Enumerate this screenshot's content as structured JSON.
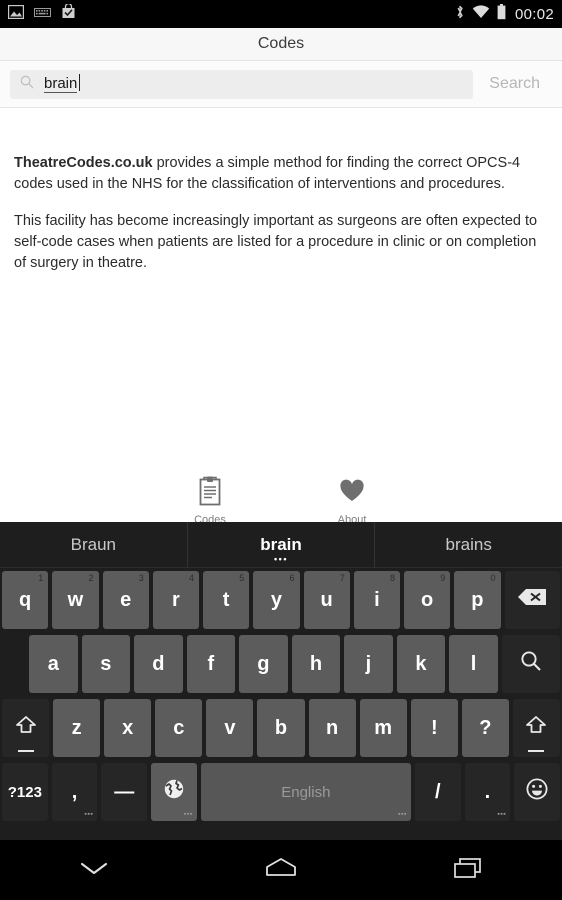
{
  "statusbar": {
    "icons_left": [
      "image-icon",
      "keyboard-icon",
      "play-store-update-icon"
    ],
    "icons_right": [
      "bluetooth-icon",
      "wifi-icon",
      "battery-icon"
    ],
    "time": "00:02"
  },
  "appbar": {
    "title": "Codes"
  },
  "search": {
    "icon": "search-icon",
    "value": "brain",
    "placeholder": "Search",
    "button_label": "Search"
  },
  "content": {
    "paragraph1_bold": "TheatreCodes.co.uk",
    "paragraph1_rest": " provides a simple method for finding the correct OPCS-4 codes used in the NHS for the classification of interventions and procedures.",
    "paragraph2": "This facility has become increasingly important as surgeons are often expected to self-code cases when patients are listed for a procedure in clinic or on completion of surgery in theatre."
  },
  "tabbar": {
    "tabs": [
      {
        "label": "Codes",
        "icon": "clipboard-icon"
      },
      {
        "label": "About",
        "icon": "heart-icon"
      }
    ]
  },
  "keyboard": {
    "suggestions": [
      {
        "text": "Braun",
        "active": false
      },
      {
        "text": "brain",
        "active": true,
        "dots": "•••"
      },
      {
        "text": "brains",
        "active": false
      }
    ],
    "row1": [
      {
        "label": "q",
        "hint": "1"
      },
      {
        "label": "w",
        "hint": "2"
      },
      {
        "label": "e",
        "hint": "3"
      },
      {
        "label": "r",
        "hint": "4"
      },
      {
        "label": "t",
        "hint": "5"
      },
      {
        "label": "y",
        "hint": "6"
      },
      {
        "label": "u",
        "hint": "7"
      },
      {
        "label": "i",
        "hint": "8"
      },
      {
        "label": "o",
        "hint": "9"
      },
      {
        "label": "p",
        "hint": "0"
      }
    ],
    "row1_action": {
      "name": "backspace-key",
      "icon": "backspace-icon"
    },
    "row2": [
      "a",
      "s",
      "d",
      "f",
      "g",
      "h",
      "j",
      "k",
      "l"
    ],
    "row2_action": {
      "name": "search-key",
      "icon": "search-icon"
    },
    "row3": [
      "z",
      "x",
      "c",
      "v",
      "b",
      "n",
      "m",
      "!",
      "?"
    ],
    "row3_shift_left": {
      "name": "shift-key-left",
      "icon": "shift-icon"
    },
    "row3_shift_right": {
      "name": "shift-key-right",
      "icon": "shift-icon"
    },
    "row4": {
      "symbols_label": "?123",
      "comma_label": ",",
      "dash_label": "—",
      "globe_icon": "globe-icon",
      "space_label": "English",
      "slash_label": "/",
      "period_label": ".",
      "emoji_icon": "emoji-icon",
      "subdots": "▪▪▪"
    }
  },
  "navbar": {
    "buttons": [
      {
        "name": "hide-keyboard-button",
        "icon": "chevron-down-icon"
      },
      {
        "name": "home-button",
        "icon": "home-icon"
      },
      {
        "name": "recents-button",
        "icon": "recents-icon"
      }
    ]
  },
  "colors": {
    "status_bar_bg": "#000000",
    "app_bar_bg": "#f7f7f7",
    "keyboard_bg": "#1e1e1e",
    "key_bg": "#5c5c5c",
    "key_dark_bg": "#262626",
    "accent_text": "#2b2b2b"
  }
}
